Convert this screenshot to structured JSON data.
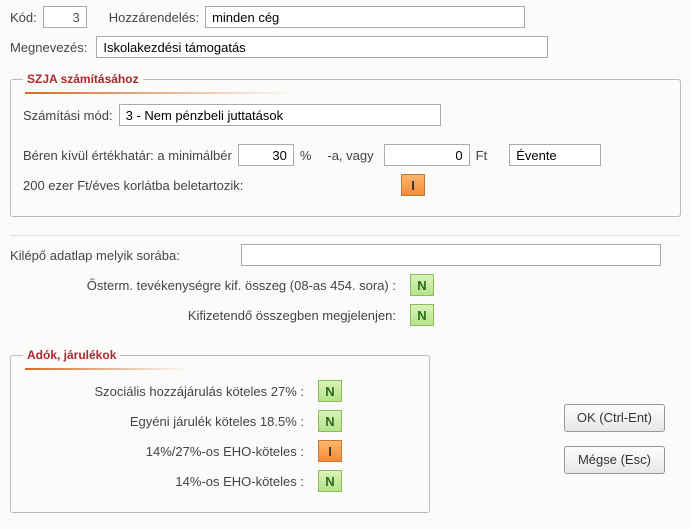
{
  "header": {
    "kod_label": "Kód:",
    "kod_value": "3",
    "hozzar_label": "Hozzárendelés:",
    "hozzar_value": "minden cég",
    "megnev_label": "Megnevezés:",
    "megnev_value": "Iskolakezdési támogatás"
  },
  "szja": {
    "legend": "SZJA számításához",
    "szam_mod_label": "Számítási mód:",
    "szam_mod_value": "3 - Nem pénzbeli juttatások",
    "beren_label": "Béren kívül értékhatár: a minimálbér",
    "beren_percent": "30",
    "beren_unit": "%",
    "beren_middle": "-a, vagy",
    "beren_amount": "0",
    "beren_amount_unit": "Ft",
    "periodus": "Évente",
    "korlat_label": "200 ezer Ft/éves korlátba beletartozik:",
    "korlat_value": "I"
  },
  "mid": {
    "kilepo_label": "Kilépő adatlap melyik sorába:",
    "kilepo_value": "",
    "osterm_label": "Ősterm. tevékenységre kif. összeg (08-as 454. sora) :",
    "osterm_value": "N",
    "megjel_label": "Kifizetendő összegben megjelenjen:",
    "megjel_value": "N"
  },
  "adok": {
    "legend": "Adók, járulékok",
    "rows": [
      {
        "label": "Szociális hozzájárulás köteles 27% :",
        "value": "N"
      },
      {
        "label": "Egyéni járulék köteles 18.5% :",
        "value": "N"
      },
      {
        "label": "14%/27%-os EHO-köteles :",
        "value": "I"
      },
      {
        "label": "14%-os EHO-köteles :",
        "value": "N"
      }
    ]
  },
  "buttons": {
    "ok": "OK (Ctrl-Ent)",
    "cancel": "Mégse (Esc)"
  }
}
